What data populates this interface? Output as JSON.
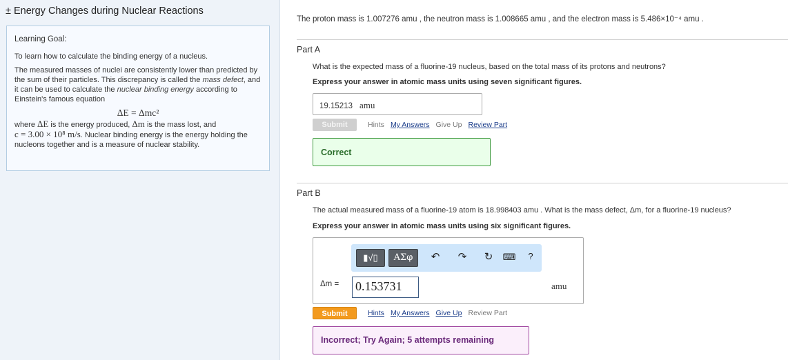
{
  "left": {
    "title": "± Energy Changes during Nuclear Reactions",
    "goal_heading": "Learning Goal:",
    "goal_text": "To learn how to calculate the binding energy of a nucleus.",
    "para1_a": "The measured masses of nuclei are consistently lower than predicted by the sum of their particles. This discrepancy is called the ",
    "para1_b": "mass defect",
    "para1_c": ", and it can be used to calculate the ",
    "para1_d": "nuclear binding energy",
    "para1_e": " according to Einstein's famous equation",
    "equation": "ΔE = Δmc²",
    "para2_a": "where ",
    "para2_dE": "ΔE",
    "para2_b": " is the energy produced, ",
    "para2_dm": "Δm",
    "para2_c": " is the mass lost, and",
    "para2_c_eq": "c = 3.00 × 10⁸ m/s",
    "para2_d": ". Nuclear binding energy is the energy holding the nucleons together and is a measure of nuclear stability."
  },
  "right": {
    "masses_text": "The proton mass is 1.007276 amu , the neutron mass is 1.008665 amu , and the electron mass is 5.486×10⁻⁴ amu .",
    "partA": {
      "heading": "Part A",
      "question": "What is the expected mass of a fluorine-19 nucleus, based on the total mass of its protons and neutrons?",
      "instruction": "Express your answer in atomic mass units using seven significant figures.",
      "answer_value": "19.15213",
      "answer_unit": "amu",
      "submit_label": "Submit",
      "links": {
        "hints": "Hints",
        "my_answers": "My Answers",
        "give_up": "Give Up",
        "review": "Review Part"
      },
      "feedback": "Correct"
    },
    "partB": {
      "heading": "Part B",
      "question": "The actual measured mass of a fluorine-19 atom is 18.998403 amu . What is the mass defect, Δm, for a fluorine-19 nucleus?",
      "instruction": "Express your answer in atomic mass units using six significant figures.",
      "toolbar": {
        "templates": "▮√▯",
        "greek": "ΑΣφ",
        "help": "?"
      },
      "input_label": "Δm =",
      "input_value": "0.153731",
      "unit": "amu",
      "submit_label": "Submit",
      "links": {
        "hints": "Hints",
        "my_answers": "My Answers",
        "give_up": "Give Up",
        "review": "Review Part"
      },
      "feedback": "Incorrect; Try Again; 5 attempts remaining"
    }
  }
}
